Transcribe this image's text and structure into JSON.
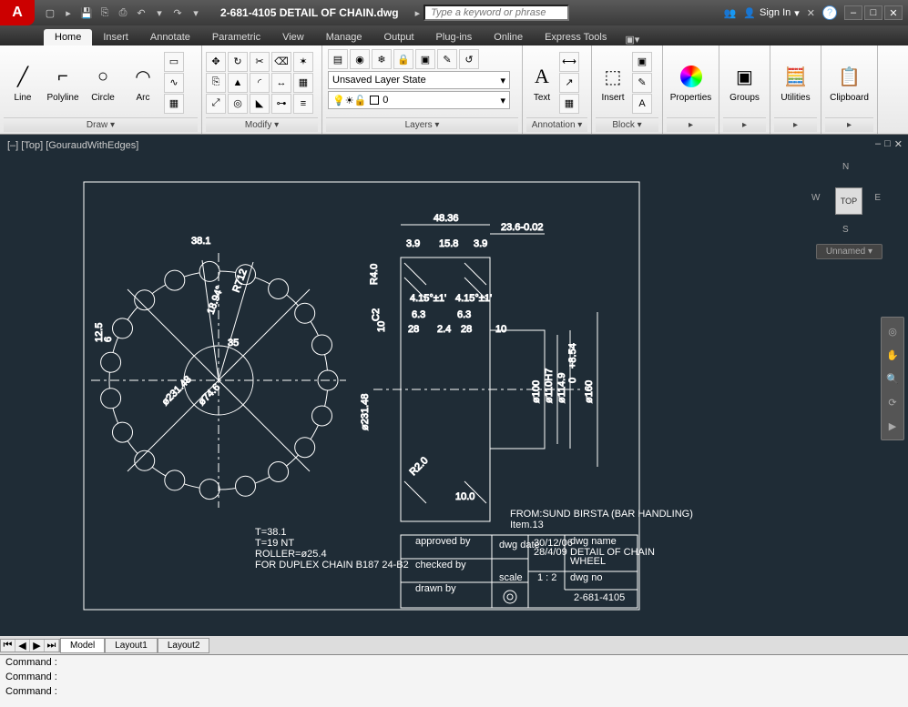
{
  "title": "2-681-4105 DETAIL OF CHAIN.dwg",
  "search_placeholder": "Type a keyword or phrase",
  "signin": "Sign In",
  "tabs": [
    "Home",
    "Insert",
    "Annotate",
    "Parametric",
    "View",
    "Manage",
    "Output",
    "Plug-ins",
    "Online",
    "Express Tools"
  ],
  "active_tab": "Home",
  "ribbon": {
    "draw": {
      "label": "Draw ▾",
      "items": [
        "Line",
        "Polyline",
        "Circle",
        "Arc"
      ]
    },
    "modify": {
      "label": "Modify ▾"
    },
    "layers": {
      "label": "Layers ▾",
      "state": "Unsaved Layer State",
      "current": "0"
    },
    "annotation": {
      "label": "Annotation ▾",
      "text": "Text"
    },
    "block": {
      "label": "Block ▾",
      "insert": "Insert"
    },
    "properties": "Properties",
    "groups": "Groups",
    "utilities": "Utilities",
    "clipboard": "Clipboard"
  },
  "view": {
    "label": "[–] [Top] [GouraudWithEdges]",
    "cube": "TOP",
    "cube_dirs": {
      "n": "N",
      "s": "S",
      "e": "E",
      "w": "W"
    },
    "unnamed": "Unnamed ▾"
  },
  "layout_tabs": [
    "Model",
    "Layout1",
    "Layout2"
  ],
  "active_layout": "Model",
  "command": {
    "history": [
      "Command :",
      "Command :"
    ],
    "prompt": "Command :"
  },
  "drawing": {
    "dims_top": [
      "48.36",
      "23.6-0.02",
      "3.9",
      "15.8",
      "3.9"
    ],
    "dims_side": [
      "6.3",
      "6.3",
      "28",
      "2.4",
      "28",
      "10",
      "10",
      "10.0",
      "R4.0",
      "R2.0",
      "C2",
      "4.15°±1'",
      "4.15°±1'"
    ],
    "diams": [
      "ø231.48",
      "ø100",
      "ø110H7",
      "ø114.9",
      "ø160",
      "ø231.48",
      "ø74.6",
      "+8.54",
      "0"
    ],
    "front": [
      "38.1",
      "18.94°",
      "R712",
      "12.5",
      "6",
      "35"
    ],
    "notes": [
      "T=38.1",
      "T=19 NT",
      "ROLLER=ø25.4",
      "FOR DUPLEX CHAIN B187 24-B2"
    ],
    "from": "FROM:SUND BIRSTA (BAR HANDLING)",
    "item": "Item.13",
    "titleblock": {
      "cols": [
        "approved by",
        "checked by",
        "drawn by"
      ],
      "dwg_date_label": "dwg date",
      "dwg_date": [
        "30/12/06",
        "28/4/09"
      ],
      "scale_label": "scale",
      "scale": "1 : 2",
      "dwg_name_label": "dwg name",
      "dwg_name": [
        "DETAIL OF CHAIN",
        "WHEEL"
      ],
      "dwg_no_label": "dwg no",
      "dwg_no": "2-681-4105"
    }
  }
}
